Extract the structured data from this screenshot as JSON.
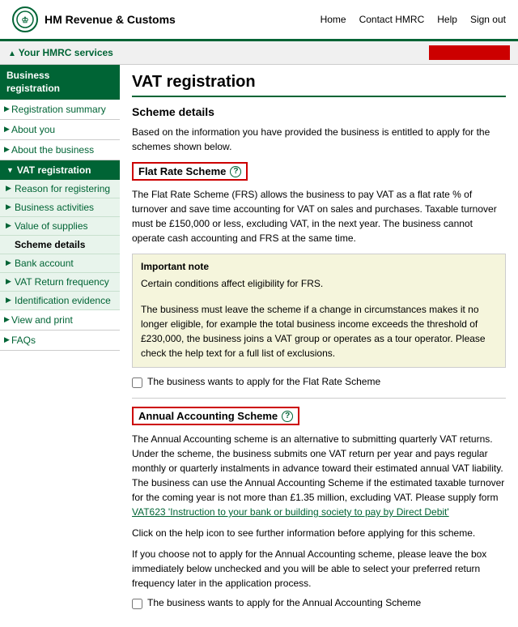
{
  "header": {
    "logo_text": "HM Revenue & Customs",
    "nav": {
      "home": "Home",
      "contact": "Contact HMRC",
      "help": "Help",
      "signout": "Sign out"
    }
  },
  "service_bar": {
    "text": "Your HMRC services"
  },
  "sidebar": {
    "section_title_line1": "Business",
    "section_title_line2": "registration",
    "items": [
      {
        "label": "Registration summary",
        "active": false
      },
      {
        "label": "About you",
        "active": false
      },
      {
        "label": "About the business",
        "active": false
      }
    ],
    "vat_section": "VAT registration",
    "vat_items": [
      {
        "label": "Reason for registering",
        "active": false
      },
      {
        "label": "Business activities",
        "active": false
      },
      {
        "label": "Value of supplies",
        "active": false
      },
      {
        "label": "Scheme details",
        "active": true
      },
      {
        "label": "Bank account",
        "active": false
      },
      {
        "label": "VAT Return frequency",
        "active": false
      },
      {
        "label": "Identification evidence",
        "active": false
      }
    ],
    "bottom_items": [
      {
        "label": "View and print"
      },
      {
        "label": "FAQs"
      }
    ]
  },
  "content": {
    "page_title": "VAT registration",
    "section_heading": "Scheme details",
    "intro": "Based on the information you have provided the business is entitled to apply for the schemes shown below.",
    "flat_rate": {
      "label": "Flat Rate Scheme",
      "description": "The Flat Rate Scheme (FRS) allows the business to pay VAT as a flat rate % of turnover and save time accounting for VAT on sales and purchases. Taxable turnover must be £150,000 or less, excluding VAT, in the next year. The business cannot operate cash accounting and FRS at the same time.",
      "important_title": "Important note",
      "important_text1": "Certain conditions affect eligibility for FRS.",
      "important_text2": "The business must leave the scheme if a change in circumstances makes it no longer eligible, for example the total business income exceeds the threshold of £230,000, the business joins a VAT group or operates as a tour operator. Please check the help text for a full list of exclusions.",
      "checkbox_label": "The business wants to apply for the Flat Rate Scheme"
    },
    "annual_accounting": {
      "label": "Annual Accounting Scheme",
      "description1": "The Annual Accounting scheme is an alternative to submitting quarterly VAT returns. Under the scheme, the business submits one VAT return per year and pays regular monthly or quarterly instalments in advance toward their estimated annual VAT liability. The business can use the Annual Accounting Scheme if the estimated taxable turnover for the coming year is not more than £1.35 million, excluding VAT. Please supply form",
      "link_text": "VAT623 'Instruction to your bank or building society to pay by Direct Debit'",
      "description2": "Click on the help icon to see further information before applying for this scheme.",
      "description3": "If you choose not to apply for the Annual Accounting scheme, please leave the box immediately below unchecked and you will be able to select your preferred return frequency later in the application process.",
      "checkbox_label": "The business wants to apply for the Annual Accounting Scheme"
    }
  }
}
